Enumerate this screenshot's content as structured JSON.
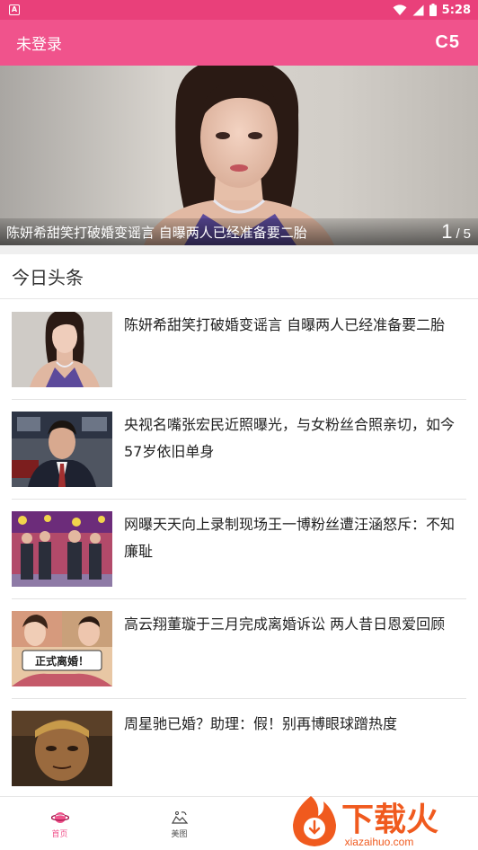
{
  "status_bar": {
    "time": "5:28",
    "notification_icon": "app-notification-icon",
    "icons": [
      "wifi-icon",
      "signal-icon",
      "battery-icon"
    ]
  },
  "app_bar": {
    "login_label": "未登录",
    "logo": "C5"
  },
  "banner": {
    "caption": "陈妍希甜笑打破婚变谣言 自曝两人已经准备要二胎",
    "current": "1",
    "separator": "/",
    "total": "5"
  },
  "section": {
    "title": "今日头条"
  },
  "news": [
    {
      "title": "陈妍希甜笑打破婚变谣言 自曝两人已经准备要二胎"
    },
    {
      "title": "央视名嘴张宏民近照曝光，与女粉丝合照亲切，如今57岁依旧单身"
    },
    {
      "title": "网曝天天向上录制现场王一博粉丝遭汪涵怒斥：不知廉耻"
    },
    {
      "title": "高云翔董璇于三月完成离婚诉讼 两人昔日恩爱回顾"
    },
    {
      "title": "周星驰已婚？助理：假！别再博眼球蹭热度"
    }
  ],
  "bottom_nav": {
    "items": [
      {
        "label": "首页",
        "icon": "planet-icon",
        "active": true
      },
      {
        "label": "美图",
        "icon": "picture-icon",
        "active": false
      }
    ]
  },
  "thumb_text": {
    "divorce_sign": "正式离婚！"
  },
  "watermark": {
    "brand": "下载火",
    "url": "xiazaihuo.com"
  },
  "colors": {
    "status_bar": "#e9407a",
    "app_bar": "#f0538c",
    "accent": "#f0538c",
    "watermark_orange": "#f05a1e"
  }
}
